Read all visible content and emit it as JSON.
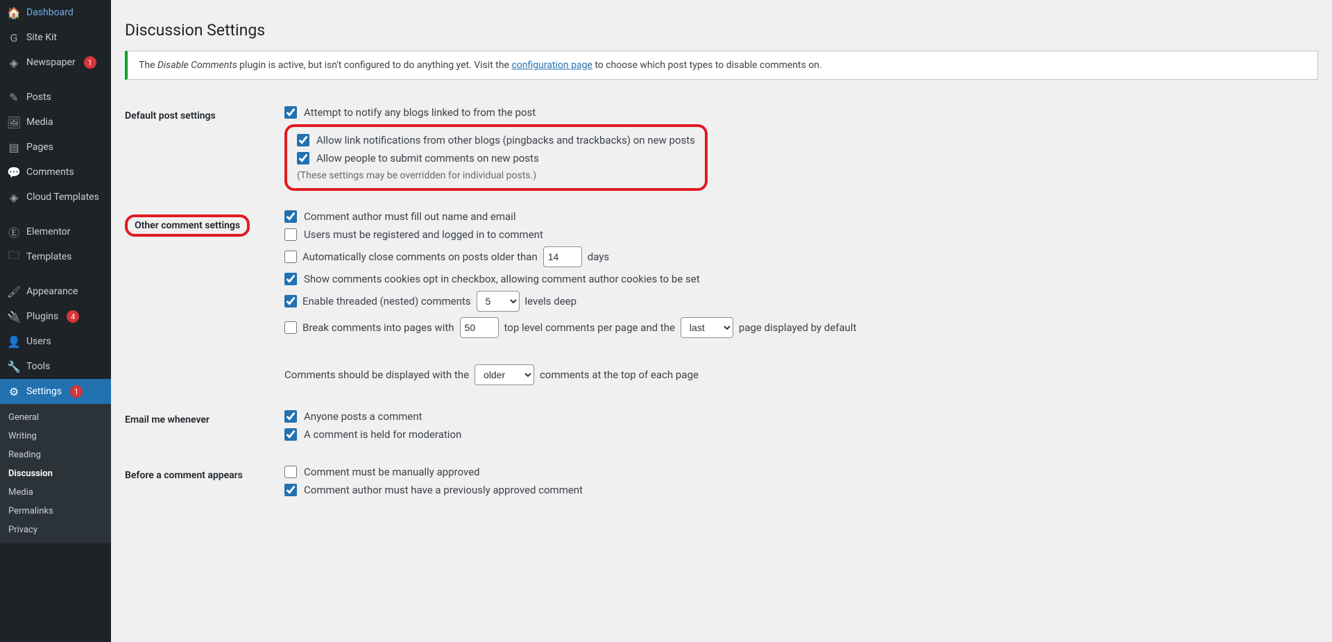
{
  "annotation": {
    "highlight_section1": "Other comment settings",
    "highlight_section2": "Default post settings block"
  },
  "sidebar": {
    "items": [
      {
        "label": "Dashboard",
        "icon": "🏠",
        "active": false
      },
      {
        "label": "Site Kit",
        "icon": "G",
        "active": false
      },
      {
        "label": "Newspaper",
        "icon": "◈",
        "active": false,
        "badge": "1"
      },
      {
        "sep": true
      },
      {
        "label": "Posts",
        "icon": "✎",
        "active": false
      },
      {
        "label": "Media",
        "icon": "🖼",
        "active": false
      },
      {
        "label": "Pages",
        "icon": "▤",
        "active": false
      },
      {
        "label": "Comments",
        "icon": "💬",
        "active": false
      },
      {
        "label": "Cloud Templates",
        "icon": "◈",
        "active": false
      },
      {
        "sep": true
      },
      {
        "label": "Elementor",
        "icon": "Ⓔ",
        "active": false
      },
      {
        "label": "Templates",
        "icon": "🗀",
        "active": false
      },
      {
        "sep": true
      },
      {
        "label": "Appearance",
        "icon": "🖌",
        "active": false
      },
      {
        "label": "Plugins",
        "icon": "🔌",
        "active": false,
        "badge": "4"
      },
      {
        "label": "Users",
        "icon": "👤",
        "active": false
      },
      {
        "label": "Tools",
        "icon": "🔧",
        "active": false
      },
      {
        "label": "Settings",
        "icon": "⚙",
        "active": true,
        "badge": "1"
      }
    ],
    "submenu": {
      "items": [
        {
          "label": "General",
          "current": false
        },
        {
          "label": "Writing",
          "current": false
        },
        {
          "label": "Reading",
          "current": false
        },
        {
          "label": "Discussion",
          "current": true
        },
        {
          "label": "Media",
          "current": false
        },
        {
          "label": "Permalinks",
          "current": false
        },
        {
          "label": "Privacy",
          "current": false
        }
      ]
    }
  },
  "page": {
    "title": "Discussion Settings"
  },
  "notice": {
    "text_before": "The ",
    "plugin_name": "Disable Comments",
    "text_mid": " plugin is active, but isn't configured to do anything yet. Visit the ",
    "link_text": "configuration page",
    "text_after": " to choose which post types to disable comments on."
  },
  "sections": {
    "default_post": {
      "heading": "Default post settings",
      "pingback_label": "Attempt to notify any blogs linked to from the post",
      "pingback_checked": true,
      "trackback_label": "Allow link notifications from other blogs (pingbacks and trackbacks) on new posts",
      "trackback_checked": true,
      "allow_comments_label": "Allow people to submit comments on new posts",
      "allow_comments_checked": true,
      "note": "(These settings may be overridden for individual posts.)"
    },
    "other_comment": {
      "heading": "Other comment settings",
      "require_name_email_label": "Comment author must fill out name and email",
      "require_name_email_checked": true,
      "must_register_label": "Users must be registered and logged in to comment",
      "must_register_checked": false,
      "autoclose_label_before": "Automatically close comments on posts older than",
      "autoclose_days_value": "14",
      "autoclose_label_after": "days",
      "autoclose_checked": false,
      "cookies_optin_label": "Show comments cookies opt in checkbox, allowing comment author cookies to be set",
      "cookies_optin_checked": true,
      "threaded_label_before": "Enable threaded (nested) comments",
      "threaded_levels_value": "5",
      "threaded_label_after": "levels deep",
      "threaded_checked": true,
      "paginate_checked": false,
      "paginate_before": "Break comments into pages with",
      "paginate_per_page_value": "50",
      "paginate_mid": "top level comments per page and the",
      "paginate_default_page_value": "last",
      "paginate_after": "page displayed by default",
      "display_order_before": "Comments should be displayed with the",
      "display_order_value": "older",
      "display_order_after": "comments at the top of each page"
    },
    "email_me": {
      "heading": "Email me whenever",
      "anyone_label": "Anyone posts a comment",
      "anyone_checked": true,
      "moderation_label": "A comment is held for moderation",
      "moderation_checked": true
    },
    "before_appears": {
      "heading": "Before a comment appears",
      "manual_label": "Comment must be manually approved",
      "manual_checked": false,
      "prev_approved_label": "Comment author must have a previously approved comment",
      "prev_approved_checked": true
    }
  }
}
